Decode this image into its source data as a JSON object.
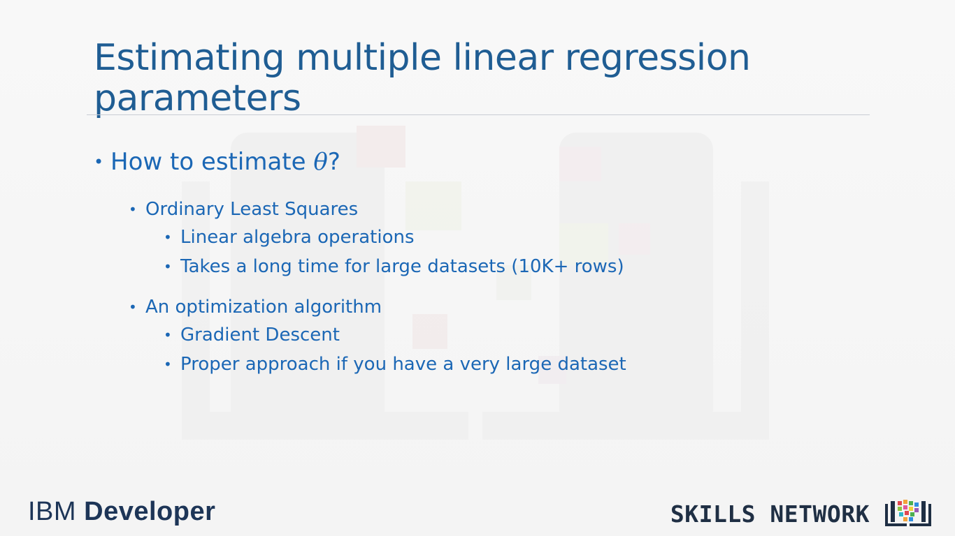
{
  "slide": {
    "title": "Estimating multiple linear regression parameters",
    "bullets": {
      "main": {
        "text_before": "How to estimate ",
        "symbol": "θ",
        "text_after": "?"
      },
      "methods": [
        {
          "label": "Ordinary Least Squares",
          "points": [
            "Linear algebra operations",
            "Takes a long time for large datasets (10K+ rows)"
          ]
        },
        {
          "label": "An optimization algorithm",
          "points": [
            "Gradient Descent",
            "Proper approach if you have a very large dataset"
          ]
        }
      ]
    }
  },
  "branding": {
    "ibm_light": "IBM",
    "ibm_bold": "Developer",
    "skills_network": "SKILLS NETWORK",
    "skills_icon": "book-pixels-icon"
  },
  "colors": {
    "title": "#1f5d93",
    "bullets": "#1b67b5",
    "logo": "#1d3557"
  }
}
